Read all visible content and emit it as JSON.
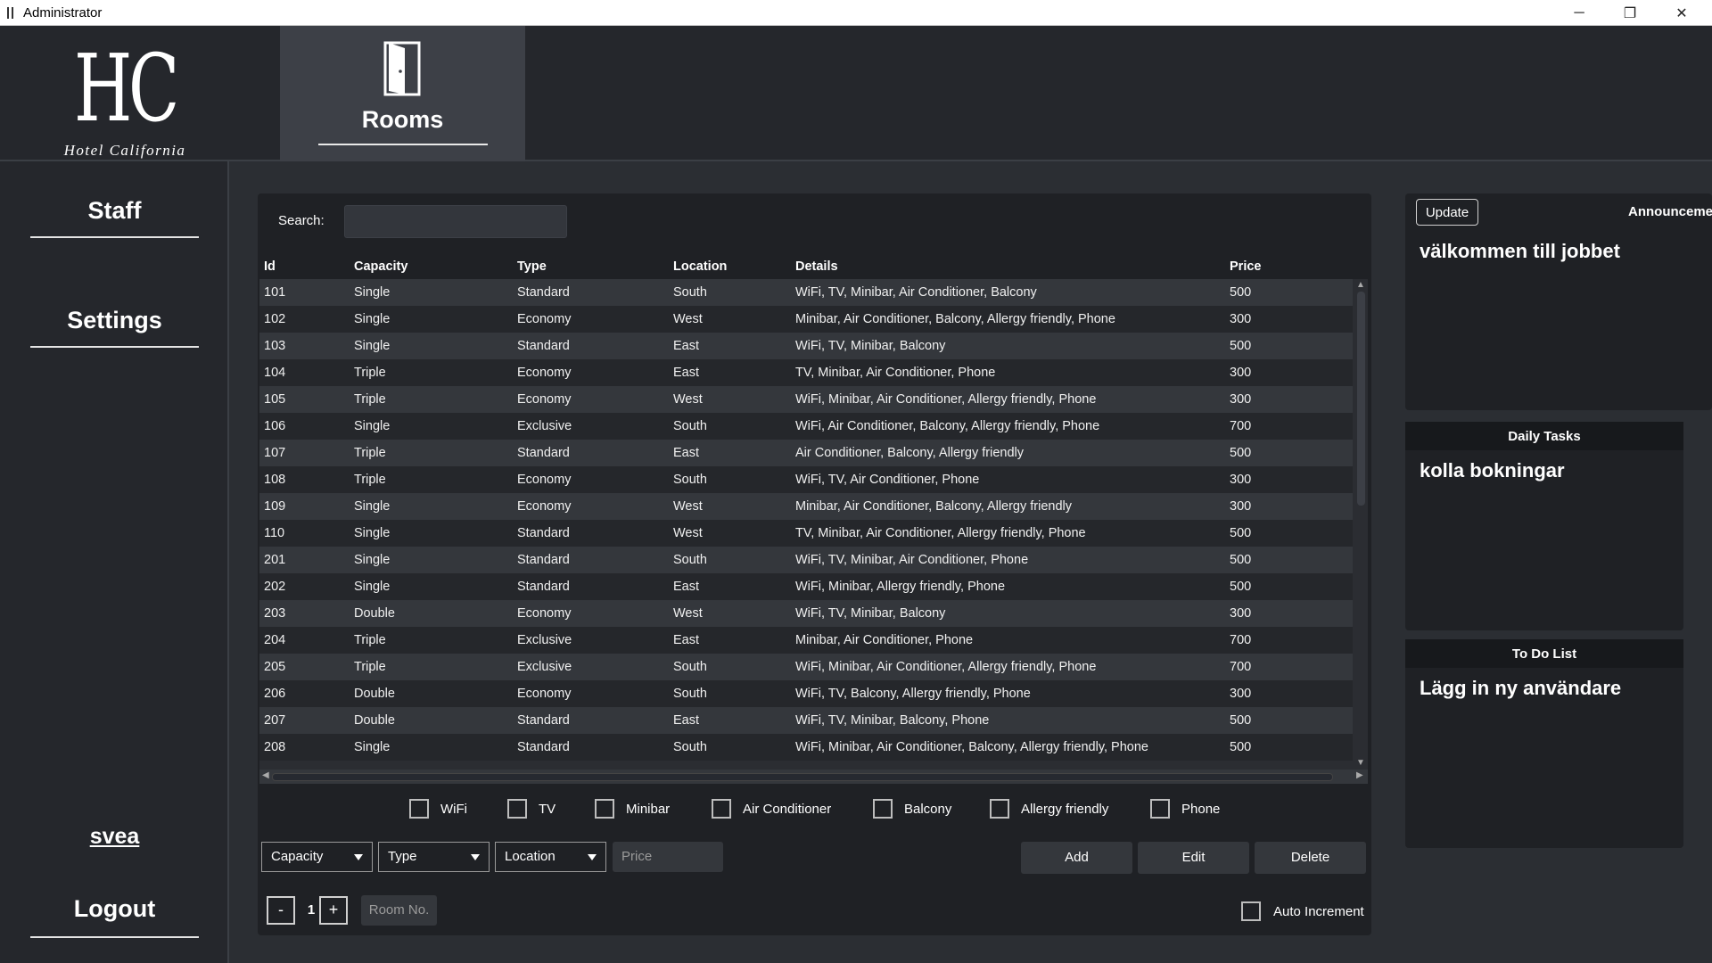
{
  "window": {
    "title": "Administrator",
    "controls": [
      "─",
      "❐",
      "✕"
    ]
  },
  "header": {
    "logo_main": "HC",
    "logo_sub": "Hotel California",
    "active_tab": "Rooms"
  },
  "sidebar": {
    "items": [
      "Staff",
      "Settings"
    ],
    "user": "svea",
    "logout": "Logout"
  },
  "search": {
    "label": "Search:",
    "value": ""
  },
  "table": {
    "columns": [
      "Id",
      "Capacity",
      "Type",
      "Location",
      "Details",
      "Price"
    ],
    "rows": [
      [
        "101",
        "Single",
        "Standard",
        "South",
        "WiFi, TV, Minibar, Air Conditioner, Balcony",
        "500"
      ],
      [
        "102",
        "Single",
        "Economy",
        "West",
        "Minibar, Air Conditioner, Balcony, Allergy friendly, Phone",
        "300"
      ],
      [
        "103",
        "Single",
        "Standard",
        "East",
        "WiFi, TV, Minibar, Balcony",
        "500"
      ],
      [
        "104",
        "Triple",
        "Economy",
        "East",
        "TV, Minibar, Air Conditioner, Phone",
        "300"
      ],
      [
        "105",
        "Triple",
        "Economy",
        "West",
        "WiFi, Minibar, Air Conditioner, Allergy friendly, Phone",
        "300"
      ],
      [
        "106",
        "Single",
        "Exclusive",
        "South",
        "WiFi, Air Conditioner, Balcony, Allergy friendly, Phone",
        "700"
      ],
      [
        "107",
        "Triple",
        "Standard",
        "East",
        "Air Conditioner, Balcony, Allergy friendly",
        "500"
      ],
      [
        "108",
        "Triple",
        "Economy",
        "South",
        "WiFi, TV, Air Conditioner, Phone",
        "300"
      ],
      [
        "109",
        "Single",
        "Economy",
        "West",
        "Minibar, Air Conditioner, Balcony, Allergy friendly",
        "300"
      ],
      [
        "110",
        "Single",
        "Standard",
        "West",
        "TV, Minibar, Air Conditioner, Allergy friendly, Phone",
        "500"
      ],
      [
        "201",
        "Single",
        "Standard",
        "South",
        "WiFi, TV, Minibar, Air Conditioner, Phone",
        "500"
      ],
      [
        "202",
        "Single",
        "Standard",
        "East",
        "WiFi, Minibar, Allergy friendly, Phone",
        "500"
      ],
      [
        "203",
        "Double",
        "Economy",
        "West",
        "WiFi, TV, Minibar, Balcony",
        "300"
      ],
      [
        "204",
        "Triple",
        "Exclusive",
        "East",
        "Minibar, Air Conditioner, Phone",
        "700"
      ],
      [
        "205",
        "Triple",
        "Exclusive",
        "South",
        "WiFi, Minibar, Air Conditioner, Allergy friendly, Phone",
        "700"
      ],
      [
        "206",
        "Double",
        "Economy",
        "South",
        "WiFi, TV, Balcony, Allergy friendly, Phone",
        "300"
      ],
      [
        "207",
        "Double",
        "Standard",
        "East",
        "WiFi, TV, Minibar, Balcony, Phone",
        "500"
      ],
      [
        "208",
        "Single",
        "Standard",
        "South",
        "WiFi, Minibar, Air Conditioner, Balcony, Allergy friendly, Phone",
        "500"
      ]
    ]
  },
  "amenities": [
    "WiFi",
    "TV",
    "Minibar",
    "Air Conditioner",
    "Balcony",
    "Allergy friendly",
    "Phone"
  ],
  "form": {
    "capacity": "Capacity",
    "type": "Type",
    "location": "Location",
    "price_placeholder": "Price",
    "add": "Add",
    "edit": "Edit",
    "delete": "Delete",
    "minus": "-",
    "plus": "+",
    "quantity": "1",
    "room_no_placeholder": "Room No.",
    "auto_increment": "Auto Increment"
  },
  "announcements": {
    "update": "Update",
    "heading": "Announceme",
    "text": "välkommen till jobbet"
  },
  "daily_tasks": {
    "heading": "Daily Tasks",
    "text": "kolla bokningar"
  },
  "todo": {
    "heading": "To Do List",
    "text": "Lägg in ny användare"
  },
  "colors": {
    "background": "#2b2e33",
    "header": "#25272c",
    "active_tab": "#3d4047",
    "panel": "#1f2125",
    "row_alt": "#34373c"
  }
}
